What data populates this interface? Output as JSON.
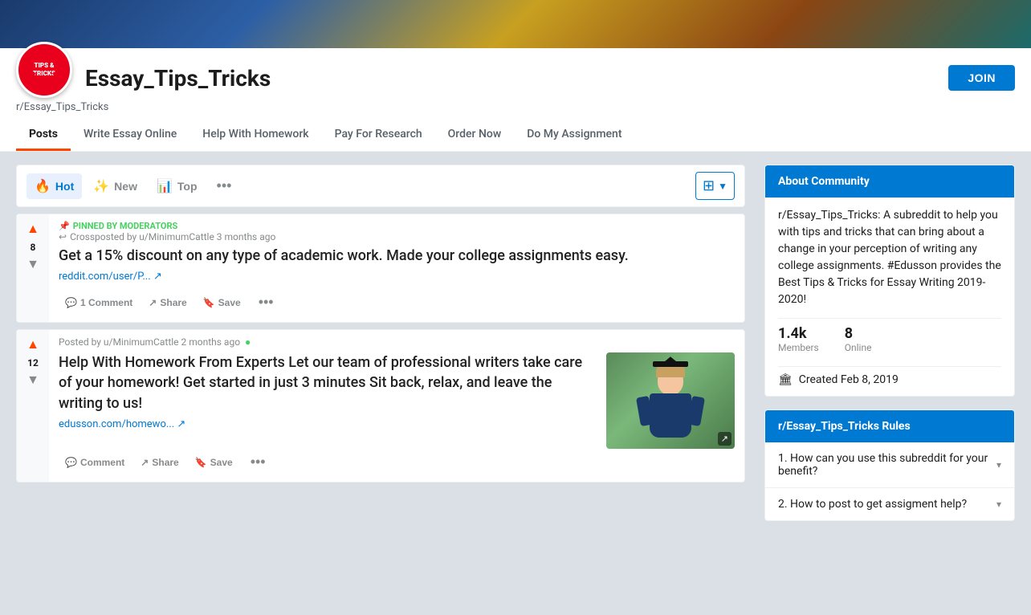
{
  "banner": {
    "gradient_desc": "blue-gold-brown-teal diagonal"
  },
  "community": {
    "logo_text_line1": "TIPS &",
    "logo_text_line2": "TRICKS",
    "title": "Essay_Tips_Tricks",
    "subreddit": "r/Essay_Tips_Tricks",
    "join_label": "JOIN"
  },
  "nav": {
    "tabs": [
      {
        "label": "Posts",
        "active": true
      },
      {
        "label": "Write Essay Online",
        "active": false
      },
      {
        "label": "Help With Homework",
        "active": false
      },
      {
        "label": "Pay For Research",
        "active": false
      },
      {
        "label": "Order Now",
        "active": false
      },
      {
        "label": "Do My Assignment",
        "active": false
      }
    ]
  },
  "sort_bar": {
    "hot_label": "Hot",
    "new_label": "New",
    "top_label": "Top",
    "dots_label": "•••"
  },
  "posts": [
    {
      "id": "post1",
      "vote_up": "▲",
      "vote_count": "8",
      "vote_down": "▼",
      "pinned": true,
      "pinned_label": "PINNED BY MODERATORS",
      "crossposted": true,
      "crosspost_info": "Crossposted by u/MinimumCattle 3 months ago",
      "title": "Get a 15% discount on any type of academic work. Made your college assignments easy.",
      "link": "reddit.com/user/P... ↗",
      "comment_label": "1 Comment",
      "share_label": "Share",
      "save_label": "Save",
      "has_thumbnail": false
    },
    {
      "id": "post2",
      "vote_up": "▲",
      "vote_count": "12",
      "vote_down": "▼",
      "pinned": false,
      "meta": "Posted by u/MinimumCattle 2 months ago",
      "title": "Help With Homework From Experts Let our team of professional writers take care of your homework! Get started in just 3 minutes Sit back, relax, and leave the writing to us!",
      "link": "edusson.com/homewo... ↗",
      "comment_label": "Comment",
      "share_label": "Share",
      "save_label": "Save",
      "has_thumbnail": true,
      "thumbnail_alt": "Graduate student photo"
    }
  ],
  "sidebar": {
    "about": {
      "header": "About Community",
      "description": "r/Essay_Tips_Tricks: A subreddit to help you with tips and tricks that can bring about a change in your perception of writing any college assignments. #Edusson provides the Best Tips & Tricks for Essay Writing 2019-2020!",
      "members_count": "1.4k",
      "members_label": "Members",
      "online_count": "8",
      "online_label": "Online",
      "created_label": "Created Feb 8, 2019"
    },
    "rules": {
      "header": "r/Essay_Tips_Tricks Rules",
      "items": [
        {
          "num": "1.",
          "text": "How can you use this subreddit for your benefit?"
        },
        {
          "num": "2.",
          "text": "How to post to get assigment help?"
        }
      ]
    }
  }
}
